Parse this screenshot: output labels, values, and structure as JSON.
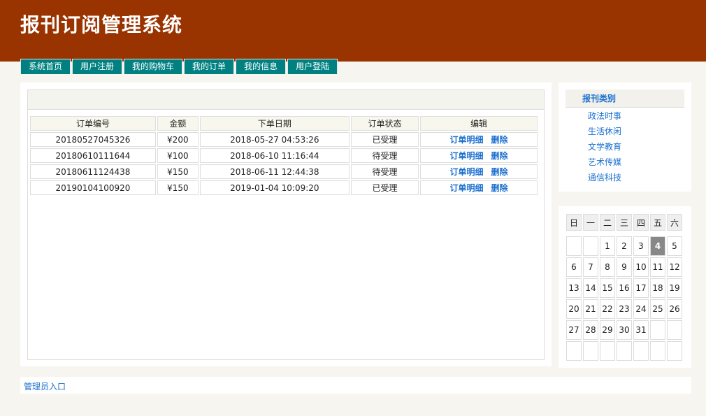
{
  "header": {
    "title": "报刊订阅管理系统"
  },
  "nav": [
    "系统首页",
    "用户注册",
    "我的购物车",
    "我的订单",
    "我的信息",
    "用户登陆"
  ],
  "orders": {
    "columns": [
      "订单编号",
      "金额",
      "下单日期",
      "订单状态",
      "编辑"
    ],
    "rows": [
      {
        "id": "20180527045326",
        "amount": "¥200",
        "date": "2018-05-27 04:53:26",
        "status": "已受理"
      },
      {
        "id": "20180610111644",
        "amount": "¥100",
        "date": "2018-06-10 11:16:44",
        "status": "待受理"
      },
      {
        "id": "20180611124438",
        "amount": "¥150",
        "date": "2018-06-11 12:44:38",
        "status": "待受理"
      },
      {
        "id": "20190104100920",
        "amount": "¥150",
        "date": "2019-01-04 10:09:20",
        "status": "已受理"
      }
    ],
    "detail_label": "订单明细",
    "delete_label": "删除"
  },
  "categories": {
    "title": "报刊类别",
    "items": [
      "政法时事",
      "生活休闲",
      "文学教育",
      "艺术传媒",
      "通信科技"
    ]
  },
  "calendar": {
    "weekdays": [
      "日",
      "一",
      "二",
      "三",
      "四",
      "五",
      "六"
    ],
    "weeks": [
      [
        "",
        "",
        "1",
        "2",
        "3",
        "4",
        "5"
      ],
      [
        "6",
        "7",
        "8",
        "9",
        "10",
        "11",
        "12"
      ],
      [
        "13",
        "14",
        "15",
        "16",
        "17",
        "18",
        "19"
      ],
      [
        "20",
        "21",
        "22",
        "23",
        "24",
        "25",
        "26"
      ],
      [
        "27",
        "28",
        "29",
        "30",
        "31",
        "",
        ""
      ],
      [
        "",
        "",
        "",
        "",
        "",
        "",
        ""
      ]
    ],
    "today": "4"
  },
  "footer": {
    "admin_link": "管理员入口"
  },
  "colors": {
    "header_bg": "#993300",
    "nav_bg": "#008080",
    "link": "#1a6fcf",
    "today_bg": "#888888"
  }
}
